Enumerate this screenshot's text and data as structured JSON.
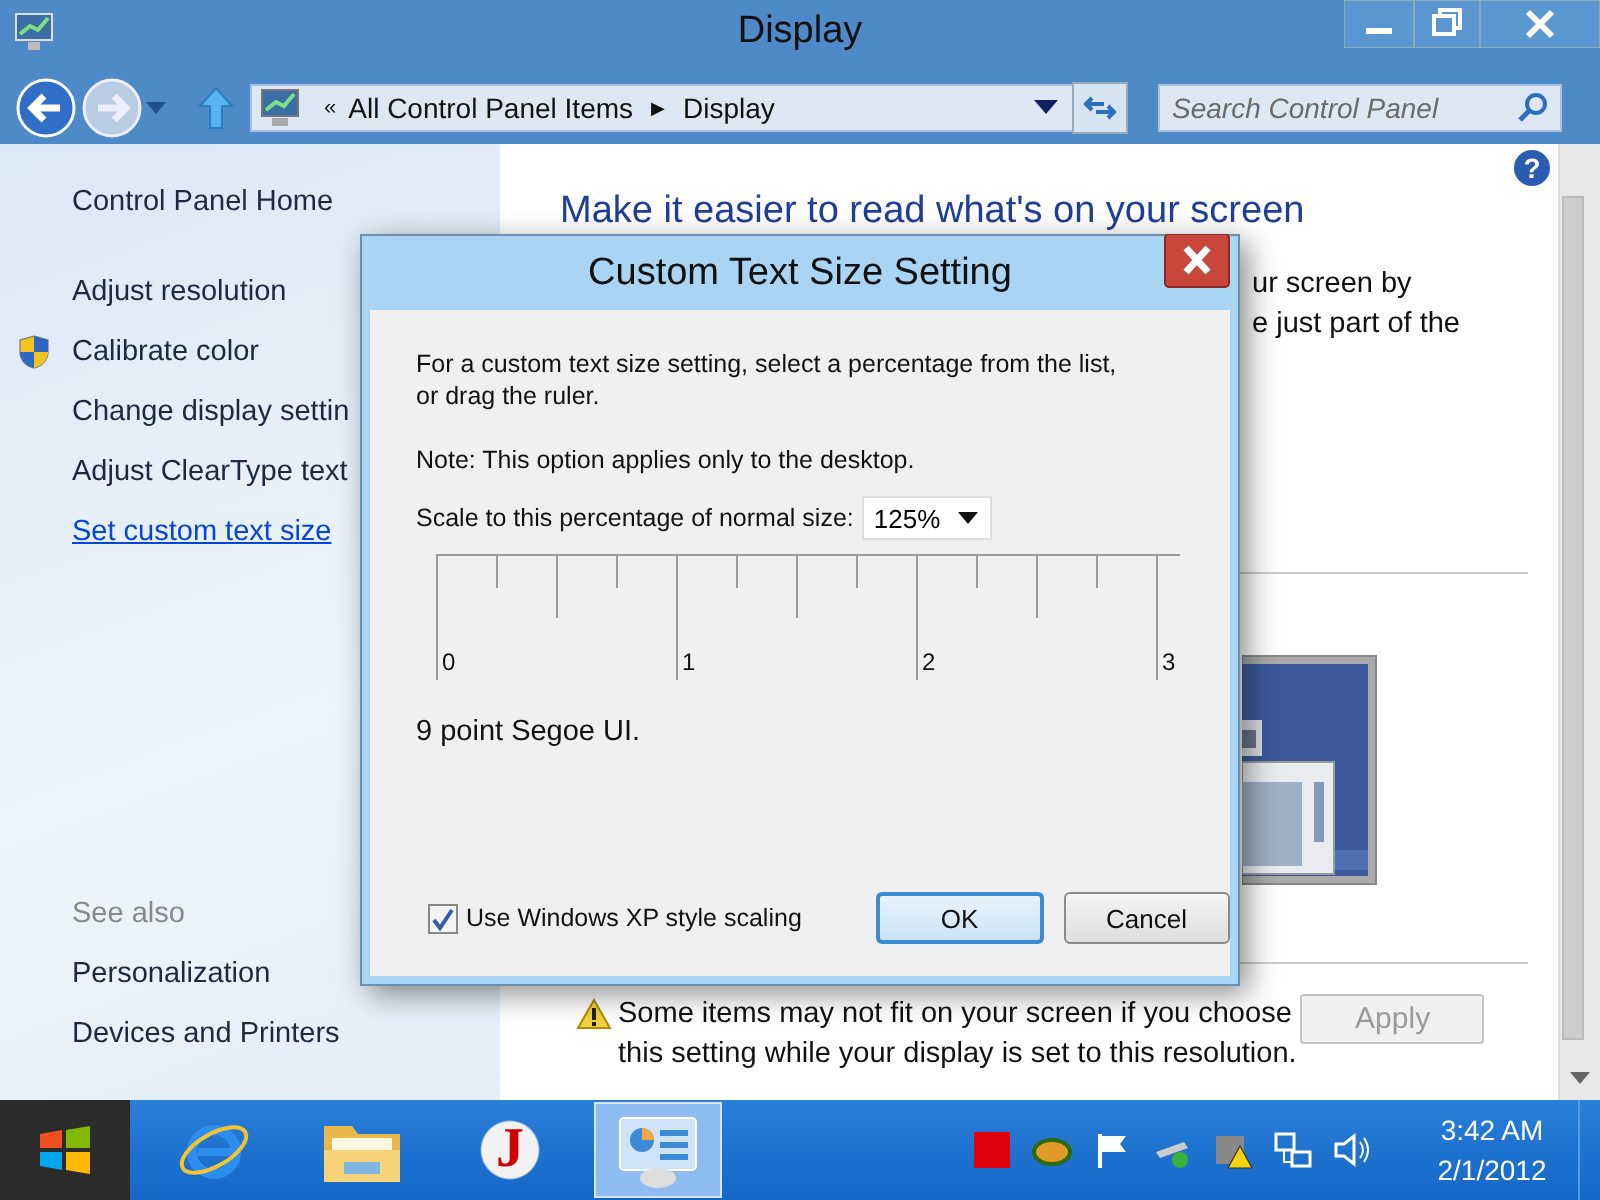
{
  "window": {
    "title": "Display"
  },
  "navigation": {
    "back_enabled": true,
    "forward_enabled": false
  },
  "address_bar": {
    "overflow": "«",
    "crumbs": [
      "All Control Panel Items",
      "Display"
    ],
    "separator": "▶"
  },
  "search": {
    "placeholder": "Search Control Panel"
  },
  "sidebar": {
    "home": "Control Panel Home",
    "items": [
      {
        "label": "Adjust resolution",
        "shield": false,
        "selected": false
      },
      {
        "label": "Calibrate color",
        "shield": true,
        "selected": false
      },
      {
        "label": "Change display settin",
        "shield": false,
        "selected": false
      },
      {
        "label": "Adjust ClearType text",
        "shield": false,
        "selected": false
      },
      {
        "label": "Set custom text size",
        "shield": false,
        "selected": true
      }
    ],
    "see_also": {
      "heading": "See also",
      "items": [
        "Personalization",
        "Devices and Printers"
      ]
    }
  },
  "main": {
    "help": "?",
    "heading": "Make it easier to read what's on your screen",
    "body_fragments": [
      "ur screen by",
      "e just part of the"
    ],
    "warning": [
      "Some items may not fit on your screen if you choose",
      "this setting while your display is set to this resolution."
    ],
    "apply": {
      "label": "Apply",
      "disabled": true
    }
  },
  "dialog": {
    "title": "Custom Text Size Setting",
    "intro": [
      "For a custom text size setting, select a percentage from the list,",
      "or drag the ruler."
    ],
    "note": "Note: This option applies only to the desktop.",
    "scale_label": "Scale to this percentage of normal size:",
    "scale_value": "125%",
    "ruler_labels": [
      "0",
      "1",
      "2",
      "3"
    ],
    "sample": "9 point Segoe UI.",
    "xp_scaling": {
      "label": "Use Windows XP style scaling",
      "checked": true
    },
    "buttons": [
      {
        "label": "OK",
        "default": true
      },
      {
        "label": "Cancel",
        "default": false
      }
    ]
  },
  "taskbar": {
    "items": [
      {
        "kind": "browser",
        "selected": false
      },
      {
        "kind": "folder",
        "selected": false
      },
      {
        "kind": "letter",
        "label": "J",
        "selected": false
      },
      {
        "kind": "control-panel",
        "selected": true
      }
    ],
    "time": "3:42 AM",
    "date": "2/1/2012"
  }
}
